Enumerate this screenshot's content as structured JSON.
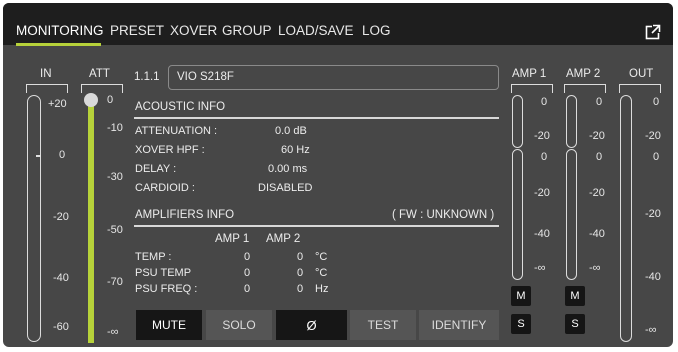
{
  "nav": {
    "tabs": [
      "MONITORING",
      "PRESET",
      "XOVER",
      "GROUP",
      "LOAD/SAVE",
      "LOG"
    ],
    "active_tab": "MONITORING",
    "expand_icon": "expand-icon"
  },
  "in_meter": {
    "label": "IN",
    "ticks": [
      "+20",
      "0",
      "-20",
      "-40",
      "-60"
    ]
  },
  "att_meter": {
    "label": "ATT",
    "ticks": [
      "0",
      "-10",
      "-30",
      "-50",
      "-70",
      "-∞"
    ],
    "level": 0,
    "accent": "#b7d23a"
  },
  "device": {
    "id": "1.1.1",
    "name": "VIO S218F"
  },
  "acoustic": {
    "title": "ACOUSTIC INFO",
    "rows": [
      {
        "label": "ATTENUATION :",
        "value": "0.0 dB"
      },
      {
        "label": "XOVER HPF :",
        "value": "60 Hz"
      },
      {
        "label": "DELAY :",
        "value": "0.00 ms"
      },
      {
        "label": "CARDIOID :",
        "value": "DISABLED"
      }
    ]
  },
  "amplifiers": {
    "title": "AMPLIFIERS INFO",
    "fw": "( FW : UNKNOWN )",
    "col1": "AMP 1",
    "col2": "AMP 2",
    "rows": [
      {
        "label": "TEMP :",
        "v1": "0",
        "v2": "0",
        "unit": "°C"
      },
      {
        "label": "PSU TEMP",
        "v1": "0",
        "v2": "0",
        "unit": "°C"
      },
      {
        "label": "PSU FREQ :",
        "v1": "0",
        "v2": "0",
        "unit": "Hz"
      }
    ]
  },
  "buttons": {
    "mute": "MUTE",
    "solo": "SOLO",
    "phase": "Ø",
    "test": "TEST",
    "identify": "IDENTIFY"
  },
  "amp1": {
    "label": "AMP 1",
    "ticks_top": [
      "0",
      "-20"
    ],
    "ticks_bottom": [
      "0",
      "-20",
      "-40",
      "-∞"
    ],
    "m": "M",
    "s": "S"
  },
  "amp2": {
    "label": "AMP 2",
    "ticks_top": [
      "0",
      "-20"
    ],
    "ticks_bottom": [
      "0",
      "-20",
      "-40",
      "-∞"
    ],
    "m": "M",
    "s": "S"
  },
  "out_meter": {
    "label": "OUT",
    "ticks": [
      "0",
      "-20",
      "0",
      "-20",
      "-40",
      "-∞"
    ]
  }
}
